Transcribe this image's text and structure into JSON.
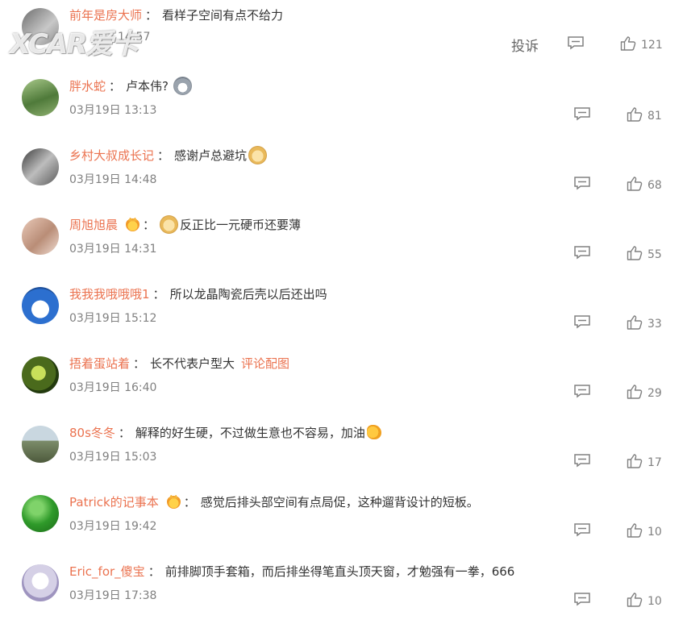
{
  "watermark": "XCAR爱卡",
  "report_label": "投诉",
  "comments": [
    {
      "user": "前年是房大师",
      "text": "看样子空间有点不给力",
      "time": "14:57",
      "likes": "121"
    },
    {
      "user": "胖水蛇",
      "text": "卢本伟?",
      "time": "03月19日 13:13",
      "likes": "81",
      "emoji": "husky-emoji"
    },
    {
      "user": "乡村大叔成长记",
      "text": "感谢卢总避坑",
      "time": "03月19日 14:48",
      "likes": "68",
      "emoji": "doge-emoji"
    },
    {
      "user": "周旭旭晨",
      "text": "反正比一元硬币还要薄",
      "time": "03月19日 14:31",
      "likes": "55",
      "emoji": "doge-emoji"
    },
    {
      "user": "我我我哦哦哦1",
      "text": "所以龙晶陶瓷后壳以后还出吗",
      "time": "03月19日 15:12",
      "likes": "33"
    },
    {
      "user": "捂着蛋站着",
      "text": "长不代表户型大",
      "link": "评论配图",
      "time": "03月19日 16:40",
      "likes": "29"
    },
    {
      "user": "80s冬冬",
      "text": "解释的好生硬，不过做生意也不容易，加油",
      "time": "03月19日 15:03",
      "likes": "17",
      "emoji": "flexed-arm-emoji"
    },
    {
      "user": "Patrick的记事本",
      "text": "感觉后排头部空间有点局促，这种遛背设计的短板。",
      "time": "03月19日 19:42",
      "likes": "10"
    },
    {
      "user": "Eric_for_傻宝",
      "text": "前排脚顶手套箱，而后排坐得笔直头顶天窗，才勉强有一拳，666",
      "time": "03月19日 17:38",
      "likes": "10"
    }
  ]
}
